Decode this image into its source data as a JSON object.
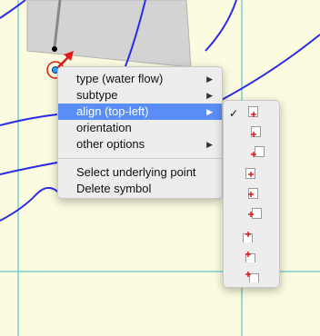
{
  "colors": {
    "map_background": "#fbfbe0",
    "river": "#2a2ae8",
    "grid_line": "#36bcc7",
    "symbol_shape": "#d3d3d3",
    "flow_arrow": "#e01818",
    "menu_highlight": "#5a8df5"
  },
  "context_menu": {
    "items": [
      {
        "label": "type (water flow)",
        "submenu": true
      },
      {
        "label": "subtype",
        "submenu": true
      },
      {
        "label": "align (top-left)",
        "submenu": true,
        "selected": true
      },
      {
        "label": "orientation",
        "submenu": false
      },
      {
        "label": "other options",
        "submenu": true
      }
    ],
    "actions": [
      {
        "label": "Select underlying point"
      },
      {
        "label": "Delete symbol"
      }
    ]
  },
  "align_submenu": {
    "checkmark": "✓",
    "selected_index": 0,
    "options": [
      {
        "icon": "align-top-left-icon"
      },
      {
        "icon": "align-top-icon"
      },
      {
        "icon": "align-top-right-icon"
      },
      {
        "icon": "align-left-icon"
      },
      {
        "icon": "align-center-icon"
      },
      {
        "icon": "align-right-icon"
      },
      {
        "icon": "align-bottom-left-icon"
      },
      {
        "icon": "align-bottom-icon"
      },
      {
        "icon": "align-bottom-right-icon"
      }
    ]
  }
}
